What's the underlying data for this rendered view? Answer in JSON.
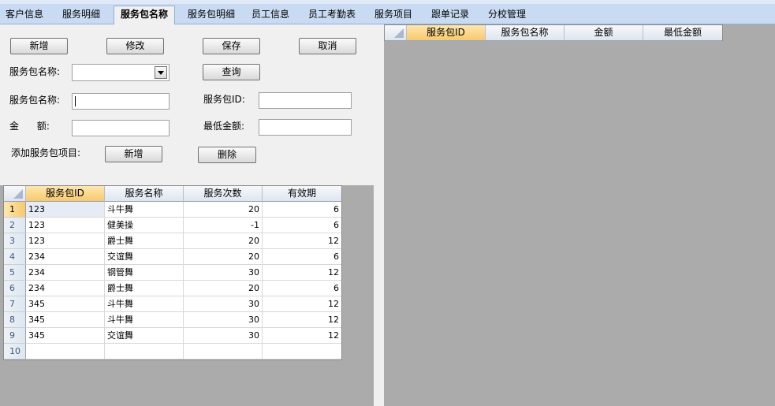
{
  "tabs": [
    {
      "label": "客户信息",
      "active": false
    },
    {
      "label": "服务明细",
      "active": false
    },
    {
      "label": "服务包名称",
      "active": true
    },
    {
      "label": "服务包明细",
      "active": false
    },
    {
      "label": "员工信息",
      "active": false
    },
    {
      "label": "员工考勤表",
      "active": false
    },
    {
      "label": "服务项目",
      "active": false
    },
    {
      "label": "跟单记录",
      "active": false
    },
    {
      "label": "分校管理",
      "active": false
    }
  ],
  "form": {
    "buttons": {
      "add": "新增",
      "edit": "修改",
      "save": "保存",
      "cancel": "取消",
      "query": "查询",
      "add_item": "新增",
      "delete": "删除"
    },
    "query_label": "服务包名称:",
    "query_value": "",
    "name_label": "服务包名称:",
    "name_value": "",
    "id_label": "服务包ID:",
    "id_value": "",
    "amount_label": "金      额:",
    "amount_value": "",
    "min_amount_label": "最低金额:",
    "min_amount_value": "",
    "add_items_label": "添加服务包项目:"
  },
  "detail_grid": {
    "columns": [
      "服务包ID",
      "服务名称",
      "服务次数",
      "有效期"
    ],
    "rows": [
      {
        "num": "1",
        "id": "123",
        "name": "斗牛舞",
        "count": "20",
        "validity": "6"
      },
      {
        "num": "2",
        "id": "123",
        "name": "健美操",
        "count": "-1",
        "validity": "6"
      },
      {
        "num": "3",
        "id": "123",
        "name": "爵士舞",
        "count": "20",
        "validity": "12"
      },
      {
        "num": "4",
        "id": "234",
        "name": "交谊舞",
        "count": "20",
        "validity": "6"
      },
      {
        "num": "5",
        "id": "234",
        "name": "钢管舞",
        "count": "30",
        "validity": "12"
      },
      {
        "num": "6",
        "id": "234",
        "name": "爵士舞",
        "count": "20",
        "validity": "6"
      },
      {
        "num": "7",
        "id": "345",
        "name": "斗牛舞",
        "count": "30",
        "validity": "12"
      },
      {
        "num": "8",
        "id": "345",
        "name": "斗牛舞",
        "count": "30",
        "validity": "12"
      },
      {
        "num": "9",
        "id": "345",
        "name": "交谊舞",
        "count": "30",
        "validity": "12"
      },
      {
        "num": "10",
        "id": "",
        "name": "",
        "count": "",
        "validity": ""
      }
    ]
  },
  "package_grid": {
    "columns": [
      "服务包ID",
      "服务包名称",
      "金额",
      "最低金额"
    ]
  }
}
